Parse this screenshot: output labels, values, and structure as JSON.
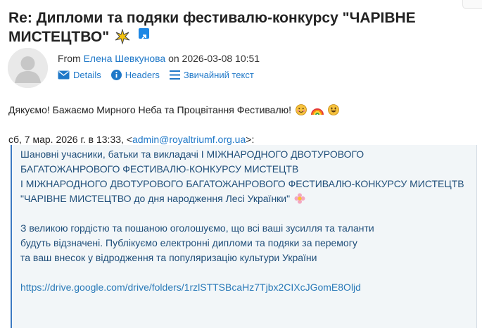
{
  "message": {
    "subject": "Re: Дипломи та подяки фестивалю-конкурсу \"ЧАРІВНЕ МИСТЕЦТВО\"",
    "from_prefix": "From",
    "from_name": "Елена Шевкунова",
    "date_prefix": "on",
    "date": "2026-03-08 10:51",
    "actions": {
      "details": "Details",
      "headers": "Headers",
      "plain_text": "Звичайний текст"
    },
    "intro": "Дякуємо! Бажаємо Мирного Неба та Процвітання Фестивалю!",
    "quote_header_prefix": "сб, 7 мар. 2026 г. в 13:33, <",
    "quote_header_email": "admin@royaltriumf.org.ua",
    "quote_header_suffix": ">:",
    "quoted": {
      "line1": "Шановні учасники, батьки та викладачі І МІЖНАРОДНОГО ДВОТУРОВОГО",
      "line2": "БАГАТОЖАНРОВОГО ФЕСТИВАЛЮ-КОНКУРСУ МИСТЕЦТВ",
      "line3": "І МІЖНАРОДНОГО ДВОТУРОВОГО БАГАТОЖАНРОВОГО ФЕСТИВАЛЮ-КОНКУРСУ МИСТЕЦТВ",
      "line4": "\"ЧАРІВНЕ МИСТЕЦТВО до дня народження Лесі Українки\"",
      "line5": "З великою гордістю та пошаною оголошуємо, що всі ваші зусилля та таланти",
      "line6": "будуть відзначені. Публікуємо електронні дипломи та подяки за перемогу",
      "line7": "та ваш внесок у відродження та популяризацію культури України",
      "link": "https://drive.google.com/drive/folders/1rzlSTTSBcaHz7Tjbx2CIXcJGomE8Oljd"
    }
  },
  "colors": {
    "accent": "#1f78c8",
    "quote_bg": "#f2f6f8",
    "quote_text": "#1f4e79",
    "quote_border": "#3b79c2"
  },
  "icons": [
    "sparkle-icon",
    "external-link-icon",
    "envelope-icon",
    "info-icon",
    "list-icon",
    "smiling-face-emoji",
    "rainbow-emoji",
    "grinning-face-emoji",
    "flower-emoji"
  ]
}
